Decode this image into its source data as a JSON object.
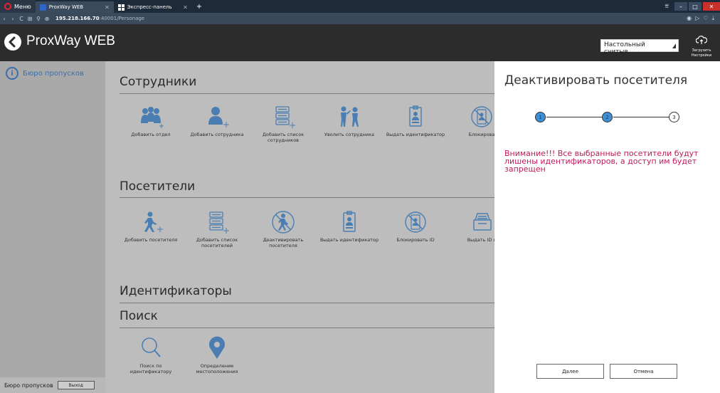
{
  "browser": {
    "menu_label": "Меню",
    "tabs": [
      {
        "label": "ProxWay WEB"
      },
      {
        "label": "Экспресс-панель"
      }
    ],
    "address_host": "195.218.166.70",
    "address_path": ":40001/Personage"
  },
  "header": {
    "title": "ProxWay WEB",
    "reader_select": "Настольный считыв...",
    "upload_label_1": "Загрузить",
    "upload_label_2": "Настройки"
  },
  "sidebar": {
    "items": [
      {
        "label": "Бюро пропусков"
      }
    ],
    "footer_label": "Бюро пропусков",
    "logout": "Выход"
  },
  "main": {
    "employees": {
      "title": "Сотрудники",
      "tiles": [
        {
          "label": "Добавить отдел",
          "icon": "add-department-icon"
        },
        {
          "label": "Добавить сотрудника",
          "icon": "add-employee-icon"
        },
        {
          "label": "Добавить список сотрудников",
          "icon": "add-employee-list-icon"
        },
        {
          "label": "Уволить сотрудника",
          "icon": "dismiss-employee-icon"
        },
        {
          "label": "Выдать идентификатор",
          "icon": "issue-id-badge-icon"
        },
        {
          "label": "Блокирова",
          "icon": "block-id-icon"
        }
      ]
    },
    "visitors": {
      "title": "Посетители",
      "tiles": [
        {
          "label": "Добавить посетителя",
          "icon": "add-visitor-icon"
        },
        {
          "label": "Добавить список посетителей",
          "icon": "add-visitor-list-icon"
        },
        {
          "label": "Деактивировать посетителя",
          "icon": "deactivate-visitor-icon"
        },
        {
          "label": "Выдать идентификатор",
          "icon": "issue-id-badge-icon"
        },
        {
          "label": "Блокировать ID",
          "icon": "block-id-icon"
        },
        {
          "label": "Выдать ID в",
          "icon": "card-box-icon"
        }
      ]
    },
    "identifiers": {
      "title": "Идентификаторы"
    },
    "search": {
      "title": "Поиск",
      "tiles": [
        {
          "label": "Поиск по идентификатору",
          "icon": "magnifier-icon"
        },
        {
          "label": "Определение местоположения",
          "icon": "location-pin-icon"
        }
      ]
    }
  },
  "drawer": {
    "title": "Деактивировать посетителя",
    "steps": [
      "1",
      "2",
      "3"
    ],
    "current_step": 2,
    "warning": "Внимание!!! Все выбранные посетители будут лишены идентификаторов, а доступ им будет запрещен",
    "next_button": "Далее",
    "cancel_button": "Отмена"
  },
  "colors": {
    "accent": "#3d8fd6",
    "icon_blue": "#4a7eb2",
    "warning": "#c2185b",
    "header_bg": "#2c2c2c"
  }
}
